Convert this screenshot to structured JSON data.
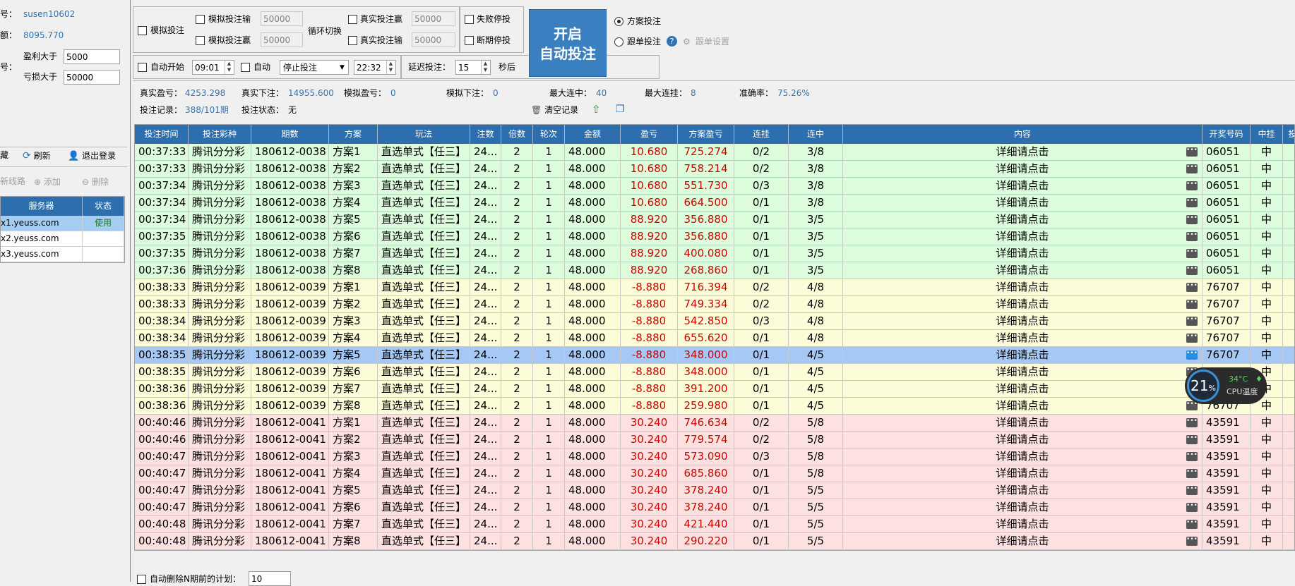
{
  "account": {
    "user_label": "号：",
    "user_value": "susen10602",
    "balance_label": "额：",
    "balance_value": "8095.770",
    "limit_label": "号：",
    "profit_gt_label": "盈利大于",
    "profit_gt_value": "5000",
    "loss_gt_label": "亏损大于",
    "loss_gt_value": "50000"
  },
  "left_toolbar": {
    "hide": "藏",
    "refresh": "刷新",
    "logout": "退出登录"
  },
  "line_toolbar": {
    "new": "新线路",
    "add": "添加",
    "delete": "删除"
  },
  "servers": {
    "headers": [
      "服务器",
      "状态"
    ],
    "rows": [
      {
        "host": "x1.yeuss.com",
        "status": "使用"
      },
      {
        "host": "x2.yeuss.com",
        "status": ""
      },
      {
        "host": "x3.yeuss.com",
        "status": ""
      }
    ]
  },
  "config": {
    "sim_bet": "模拟投注",
    "sim_lose": "模拟投注输",
    "sim_lose_val": "50000",
    "sim_win": "模拟投注赢",
    "sim_win_val": "50000",
    "cycle": "循环切换",
    "real_win": "真实投注赢",
    "real_win_val": "50000",
    "real_lose": "真实投注输",
    "real_lose_val": "50000",
    "fail_stop": "失败停投",
    "break_stop": "断期停投",
    "auto_start": "自动开始",
    "start_time": "09:01",
    "auto": "自动",
    "stop_mode": "停止投注",
    "end_time": "22:32",
    "delay_label": "延迟投注：",
    "delay_value": "15",
    "delay_unit": "秒后",
    "start_btn_line1": "开启",
    "start_btn_line2": "自动投注",
    "plan_bet": "方案投注",
    "follow_bet": "跟单投注",
    "follow_settings": "跟单设置"
  },
  "stats": {
    "real_pl_label": "真实盈亏：",
    "real_pl": "4253.298",
    "real_bet_label": "真实下注：",
    "real_bet": "14955.600",
    "sim_pl_label": "模拟盈亏：",
    "sim_pl": "0",
    "sim_bet_label": "模拟下注：",
    "sim_bet": "0",
    "max_win_label": "最大连中：",
    "max_win": "40",
    "max_hang_label": "最大连挂：",
    "max_hang": "8",
    "accuracy_label": "准确率：",
    "accuracy": "75.26%",
    "record_label": "投注记录：",
    "record": "388/101期",
    "state_label": "投注状态：",
    "state": "无",
    "clear": "清空记录"
  },
  "table": {
    "headers": [
      "投注时间",
      "投注彩种",
      "期数",
      "方案",
      "玩法",
      "注数",
      "倍数",
      "轮次",
      "金额",
      "盈亏",
      "方案盈亏",
      "连挂",
      "连中",
      "内容",
      "开奖号码",
      "中挂",
      "投注"
    ],
    "rows": [
      [
        "00:37:33",
        "腾讯分分彩",
        "180612-0038",
        "方案1",
        "直选单式【任三】",
        "24...",
        "2",
        "1",
        "48.000",
        "10.680",
        "725.274",
        "0/2",
        "3/8",
        "详细请点击",
        "06051",
        "中",
        "win"
      ],
      [
        "00:37:33",
        "腾讯分分彩",
        "180612-0038",
        "方案2",
        "直选单式【任三】",
        "24...",
        "2",
        "1",
        "48.000",
        "10.680",
        "758.214",
        "0/2",
        "3/8",
        "详细请点击",
        "06051",
        "中",
        "win"
      ],
      [
        "00:37:34",
        "腾讯分分彩",
        "180612-0038",
        "方案3",
        "直选单式【任三】",
        "24...",
        "2",
        "1",
        "48.000",
        "10.680",
        "551.730",
        "0/3",
        "3/8",
        "详细请点击",
        "06051",
        "中",
        "win"
      ],
      [
        "00:37:34",
        "腾讯分分彩",
        "180612-0038",
        "方案4",
        "直选单式【任三】",
        "24...",
        "2",
        "1",
        "48.000",
        "10.680",
        "664.500",
        "0/1",
        "3/8",
        "详细请点击",
        "06051",
        "中",
        "win"
      ],
      [
        "00:37:34",
        "腾讯分分彩",
        "180612-0038",
        "方案5",
        "直选单式【任三】",
        "24...",
        "2",
        "1",
        "48.000",
        "88.920",
        "356.880",
        "0/1",
        "3/5",
        "详细请点击",
        "06051",
        "中",
        "win"
      ],
      [
        "00:37:35",
        "腾讯分分彩",
        "180612-0038",
        "方案6",
        "直选单式【任三】",
        "24...",
        "2",
        "1",
        "48.000",
        "88.920",
        "356.880",
        "0/1",
        "3/5",
        "详细请点击",
        "06051",
        "中",
        "win"
      ],
      [
        "00:37:35",
        "腾讯分分彩",
        "180612-0038",
        "方案7",
        "直选单式【任三】",
        "24...",
        "2",
        "1",
        "48.000",
        "88.920",
        "400.080",
        "0/1",
        "3/5",
        "详细请点击",
        "06051",
        "中",
        "win"
      ],
      [
        "00:37:36",
        "腾讯分分彩",
        "180612-0038",
        "方案8",
        "直选单式【任三】",
        "24...",
        "2",
        "1",
        "48.000",
        "88.920",
        "268.860",
        "0/1",
        "3/5",
        "详细请点击",
        "06051",
        "中",
        "win"
      ],
      [
        "00:38:33",
        "腾讯分分彩",
        "180612-0039",
        "方案1",
        "直选单式【任三】",
        "24...",
        "2",
        "1",
        "48.000",
        "-8.880",
        "716.394",
        "0/2",
        "4/8",
        "详细请点击",
        "76707",
        "中",
        "lose"
      ],
      [
        "00:38:33",
        "腾讯分分彩",
        "180612-0039",
        "方案2",
        "直选单式【任三】",
        "24...",
        "2",
        "1",
        "48.000",
        "-8.880",
        "749.334",
        "0/2",
        "4/8",
        "详细请点击",
        "76707",
        "中",
        "lose"
      ],
      [
        "00:38:34",
        "腾讯分分彩",
        "180612-0039",
        "方案3",
        "直选单式【任三】",
        "24...",
        "2",
        "1",
        "48.000",
        "-8.880",
        "542.850",
        "0/3",
        "4/8",
        "详细请点击",
        "76707",
        "中",
        "lose"
      ],
      [
        "00:38:34",
        "腾讯分分彩",
        "180612-0039",
        "方案4",
        "直选单式【任三】",
        "24...",
        "2",
        "1",
        "48.000",
        "-8.880",
        "655.620",
        "0/1",
        "4/8",
        "详细请点击",
        "76707",
        "中",
        "lose"
      ],
      [
        "00:38:35",
        "腾讯分分彩",
        "180612-0039",
        "方案5",
        "直选单式【任三】",
        "24...",
        "2",
        "1",
        "48.000",
        "-8.880",
        "348.000",
        "0/1",
        "4/5",
        "详细请点击",
        "76707",
        "中",
        "sel"
      ],
      [
        "00:38:35",
        "腾讯分分彩",
        "180612-0039",
        "方案6",
        "直选单式【任三】",
        "24...",
        "2",
        "1",
        "48.000",
        "-8.880",
        "348.000",
        "0/1",
        "4/5",
        "详细请点击",
        "",
        "中",
        "lose"
      ],
      [
        "00:38:36",
        "腾讯分分彩",
        "180612-0039",
        "方案7",
        "直选单式【任三】",
        "24...",
        "2",
        "1",
        "48.000",
        "-8.880",
        "391.200",
        "0/1",
        "4/5",
        "详细请点击",
        "",
        "中",
        "lose"
      ],
      [
        "00:38:36",
        "腾讯分分彩",
        "180612-0039",
        "方案8",
        "直选单式【任三】",
        "24...",
        "2",
        "1",
        "48.000",
        "-8.880",
        "259.980",
        "0/1",
        "4/5",
        "详细请点击",
        "76707",
        "中",
        "lose"
      ],
      [
        "00:40:46",
        "腾讯分分彩",
        "180612-0041",
        "方案1",
        "直选单式【任三】",
        "24...",
        "2",
        "1",
        "48.000",
        "30.240",
        "746.634",
        "0/2",
        "5/8",
        "详细请点击",
        "43591",
        "中",
        "pink"
      ],
      [
        "00:40:46",
        "腾讯分分彩",
        "180612-0041",
        "方案2",
        "直选单式【任三】",
        "24...",
        "2",
        "1",
        "48.000",
        "30.240",
        "779.574",
        "0/2",
        "5/8",
        "详细请点击",
        "43591",
        "中",
        "pink"
      ],
      [
        "00:40:47",
        "腾讯分分彩",
        "180612-0041",
        "方案3",
        "直选单式【任三】",
        "24...",
        "2",
        "1",
        "48.000",
        "30.240",
        "573.090",
        "0/3",
        "5/8",
        "详细请点击",
        "43591",
        "中",
        "pink"
      ],
      [
        "00:40:47",
        "腾讯分分彩",
        "180612-0041",
        "方案4",
        "直选单式【任三】",
        "24...",
        "2",
        "1",
        "48.000",
        "30.240",
        "685.860",
        "0/1",
        "5/8",
        "详细请点击",
        "43591",
        "中",
        "pink"
      ],
      [
        "00:40:47",
        "腾讯分分彩",
        "180612-0041",
        "方案5",
        "直选单式【任三】",
        "24...",
        "2",
        "1",
        "48.000",
        "30.240",
        "378.240",
        "0/1",
        "5/5",
        "详细请点击",
        "43591",
        "中",
        "pink"
      ],
      [
        "00:40:47",
        "腾讯分分彩",
        "180612-0041",
        "方案6",
        "直选单式【任三】",
        "24...",
        "2",
        "1",
        "48.000",
        "30.240",
        "378.240",
        "0/1",
        "5/5",
        "详细请点击",
        "43591",
        "中",
        "pink"
      ],
      [
        "00:40:48",
        "腾讯分分彩",
        "180612-0041",
        "方案7",
        "直选单式【任三】",
        "24...",
        "2",
        "1",
        "48.000",
        "30.240",
        "421.440",
        "0/1",
        "5/5",
        "详细请点击",
        "43591",
        "中",
        "pink"
      ],
      [
        "00:40:48",
        "腾讯分分彩",
        "180612-0041",
        "方案8",
        "直选单式【任三】",
        "24...",
        "2",
        "1",
        "48.000",
        "30.240",
        "290.220",
        "0/1",
        "5/5",
        "详细请点击",
        "43591",
        "中",
        "pink"
      ]
    ]
  },
  "bottom": {
    "auto_delete": "自动删除N期前的计划：",
    "auto_delete_value": "10"
  },
  "cpu_widget": {
    "percent": "21",
    "percent_unit": "%",
    "temp": "34°C",
    "label": "CPU温度"
  },
  "colors": {
    "header": "#2d6fae",
    "win": "#dcfcdc",
    "lose": "#fdfcd8",
    "pink": "#fde1e1",
    "selected": "#a5c9f4",
    "value_red": "#d40000",
    "value_blue": "#2e75b6"
  }
}
